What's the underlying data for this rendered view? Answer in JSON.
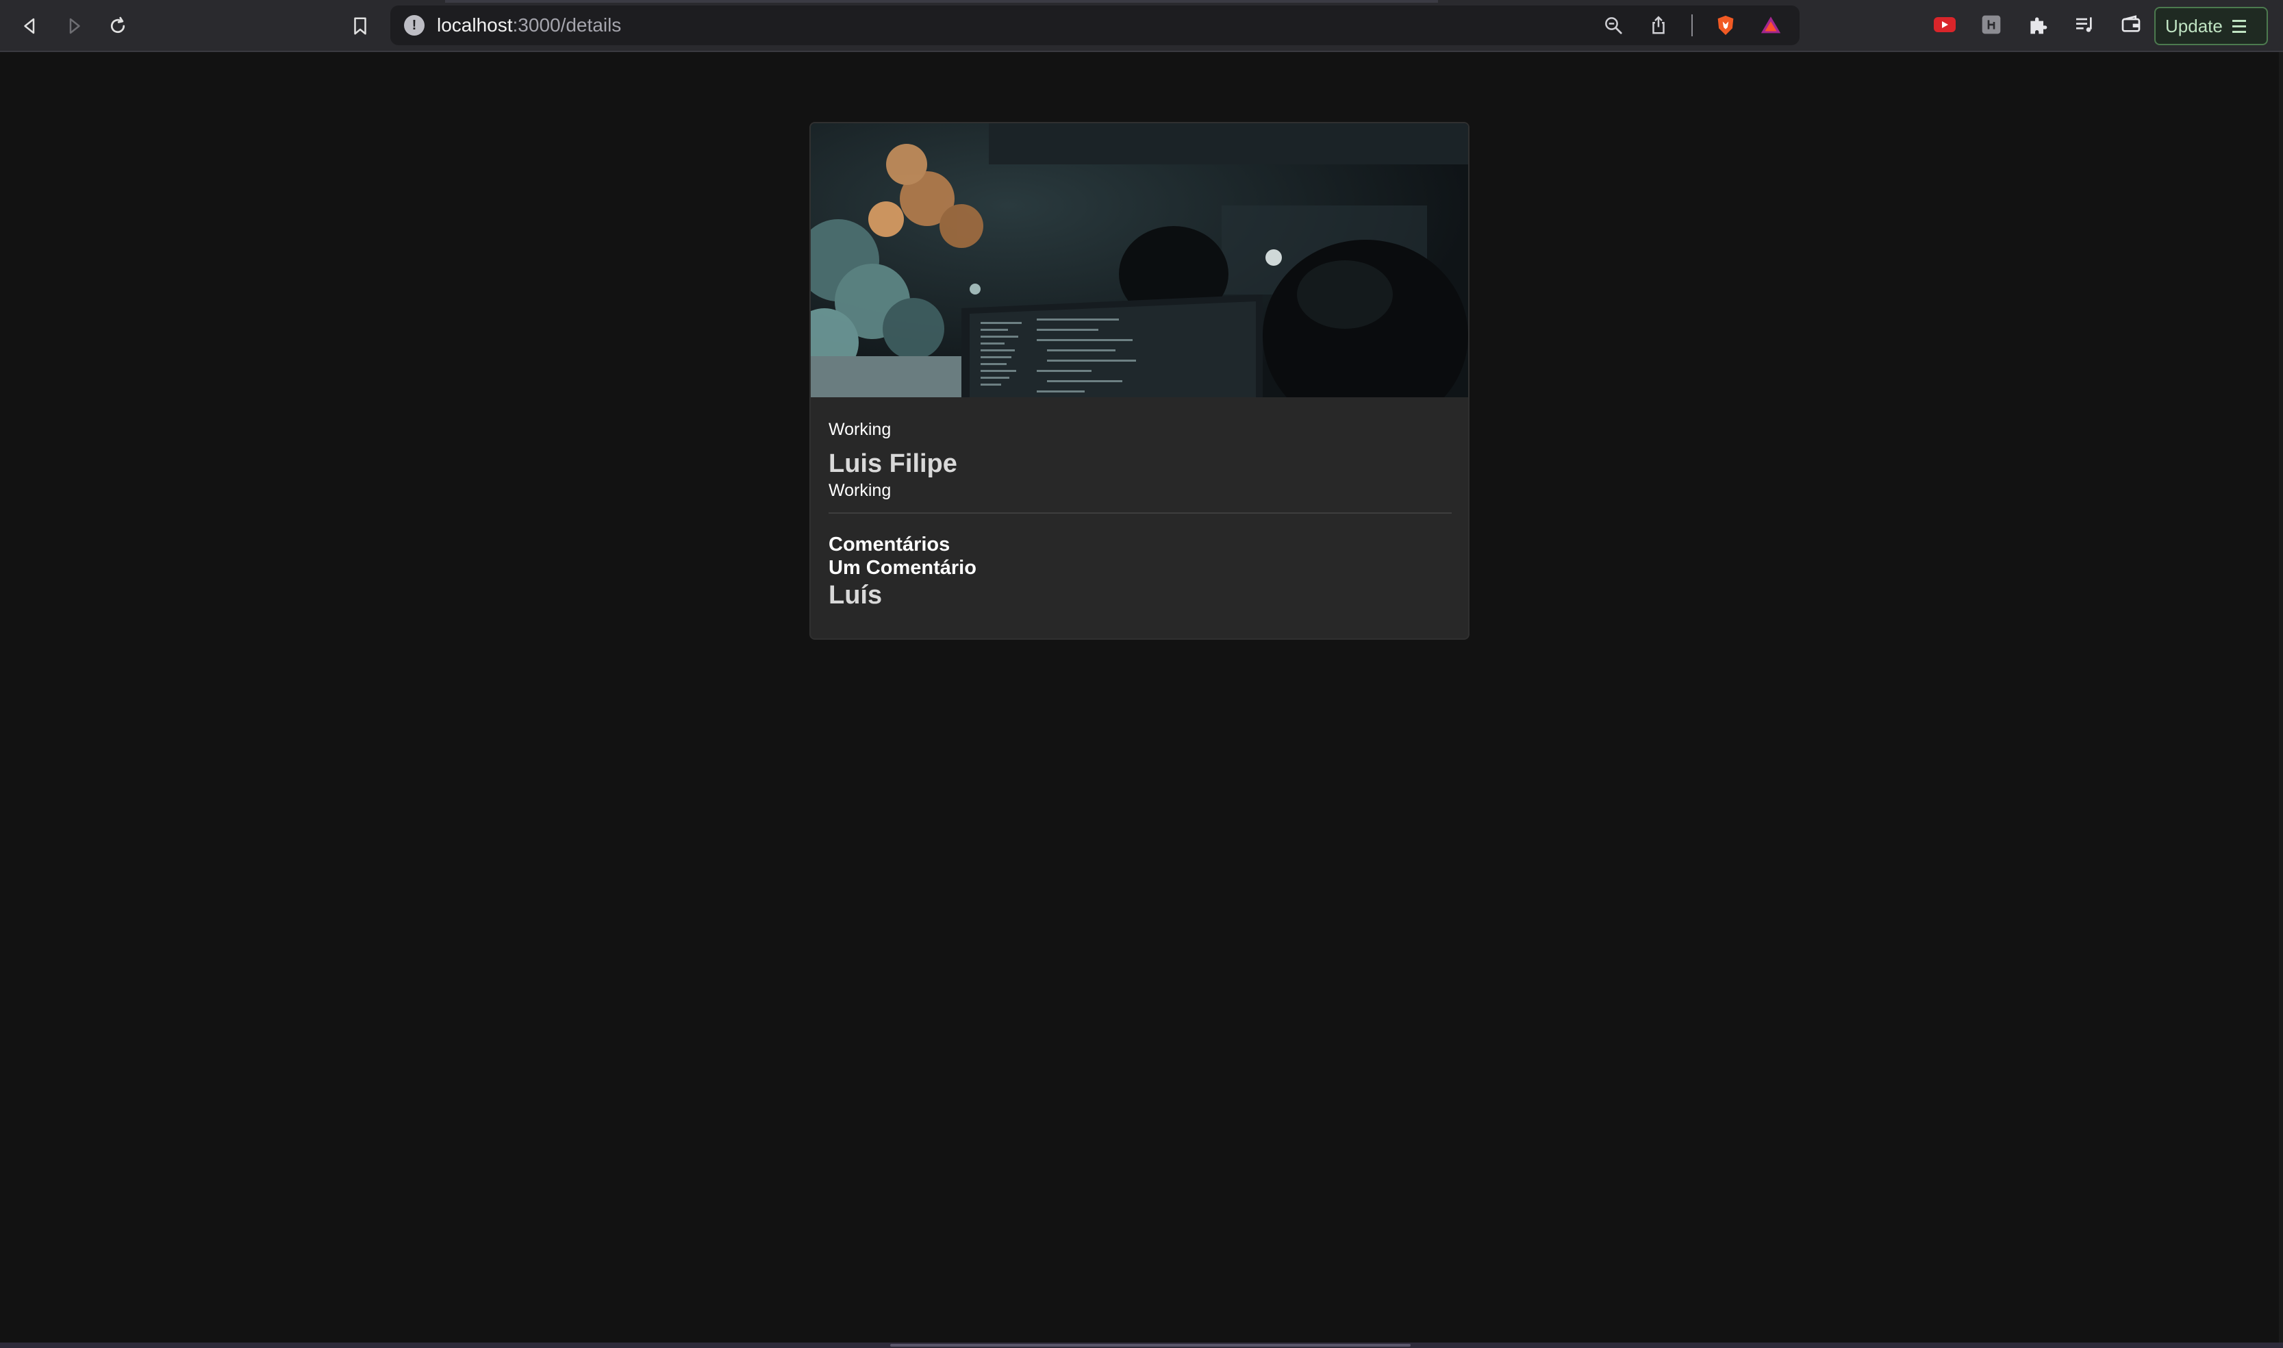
{
  "browser": {
    "url_host": "localhost",
    "url_path": ":3000/details",
    "update_label": "Update",
    "icons": {
      "back": "back-icon",
      "forward": "forward-icon",
      "reload": "reload-icon",
      "bookmark": "bookmark-icon",
      "site_info": "info-icon",
      "zoom": "zoom-out-icon",
      "share": "share-icon",
      "shield": "brave-shield-icon",
      "rewards": "brave-rewards-icon",
      "extensions": [
        "youtube-extension-icon",
        "extension-icon",
        "puzzle-extensions-icon",
        "playlist-icon",
        "wallet-icon"
      ]
    },
    "colors": {
      "toolbar": "#2a2a2e",
      "page_bg": "#121212",
      "card_bg": "#282828",
      "update_border": "#4c7a4f"
    }
  },
  "details": {
    "category": "Working",
    "title": "Luis Filipe",
    "subtitle": "Working",
    "comments_heading": "Comentários",
    "comments": [
      {
        "text": "Um Comentário",
        "author": "Luís"
      }
    ]
  }
}
